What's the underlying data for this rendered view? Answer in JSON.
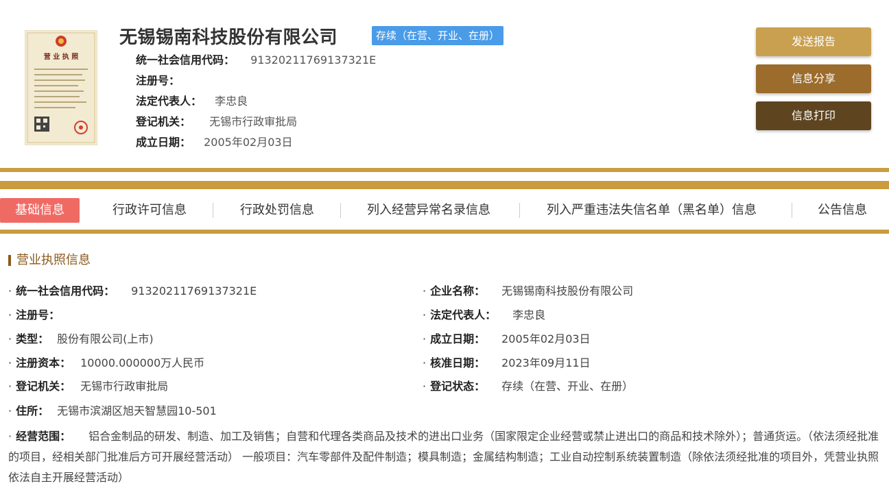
{
  "header": {
    "company_name": "无锡锡南科技股份有限公司",
    "status": "存续（在营、开业、在册）",
    "rows": [
      {
        "label": "统一社会信用代码：",
        "value": "91320211769137321E"
      },
      {
        "label": "注册号：",
        "value": ""
      },
      {
        "label": "法定代表人：",
        "value": "李忠良"
      },
      {
        "label": "登记机关：",
        "value": "无锡市行政审批局"
      },
      {
        "label": "成立日期：",
        "value": "2005年02月03日"
      }
    ],
    "license_title": "营 业 执 照"
  },
  "actions": {
    "send_report": "发送报告",
    "share_info": "信息分享",
    "print_info": "信息打印"
  },
  "tabs": [
    "基础信息",
    "行政许可信息",
    "行政处罚信息",
    "列入经营异常名录信息",
    "列入严重违法失信名单（黑名单）信息",
    "公告信息"
  ],
  "section": {
    "title": "营业执照信息",
    "left": [
      {
        "label": "统一社会信用代码：",
        "value": "91320211769137321E"
      },
      {
        "label": "注册号：",
        "value": ""
      },
      {
        "label": "类型：",
        "value": "股份有限公司(上市)"
      },
      {
        "label": "注册资本：",
        "value": "10000.000000万人民币"
      },
      {
        "label": "登记机关：",
        "value": "无锡市行政审批局"
      },
      {
        "label": "住所：",
        "value": "无锡市滨湖区旭天智慧园10-501"
      }
    ],
    "right": [
      {
        "label": "企业名称：",
        "value": "无锡锡南科技股份有限公司"
      },
      {
        "label": "法定代表人：",
        "value": "李忠良"
      },
      {
        "label": "成立日期：",
        "value": "2005年02月03日"
      },
      {
        "label": "核准日期：",
        "value": "2023年09月11日"
      },
      {
        "label": "登记状态：",
        "value": "存续（在营、开业、在册）"
      }
    ],
    "scope_label": "经营范围：",
    "scope_value": "铝合金制品的研发、制造、加工及销售；自营和代理各类商品及技术的进出口业务（国家限定企业经营或禁止进出口的商品和技术除外）；普通货运。（依法须经批准的项目，经相关部门批准后方可开展经营活动） 一般项目：汽车零部件及配件制造；模具制造；金属结构制造；工业自动控制系统装置制造（除依法须经批准的项目外，凭营业执照依法自主开展经营活动）"
  },
  "colors": {
    "gold_band": "#c99c3e",
    "active_tab": "#f06a64",
    "status_badge": "#4a9be8",
    "btn_send": "#c9a050",
    "btn_share": "#9b6c2c",
    "btn_print": "#5e4520"
  }
}
